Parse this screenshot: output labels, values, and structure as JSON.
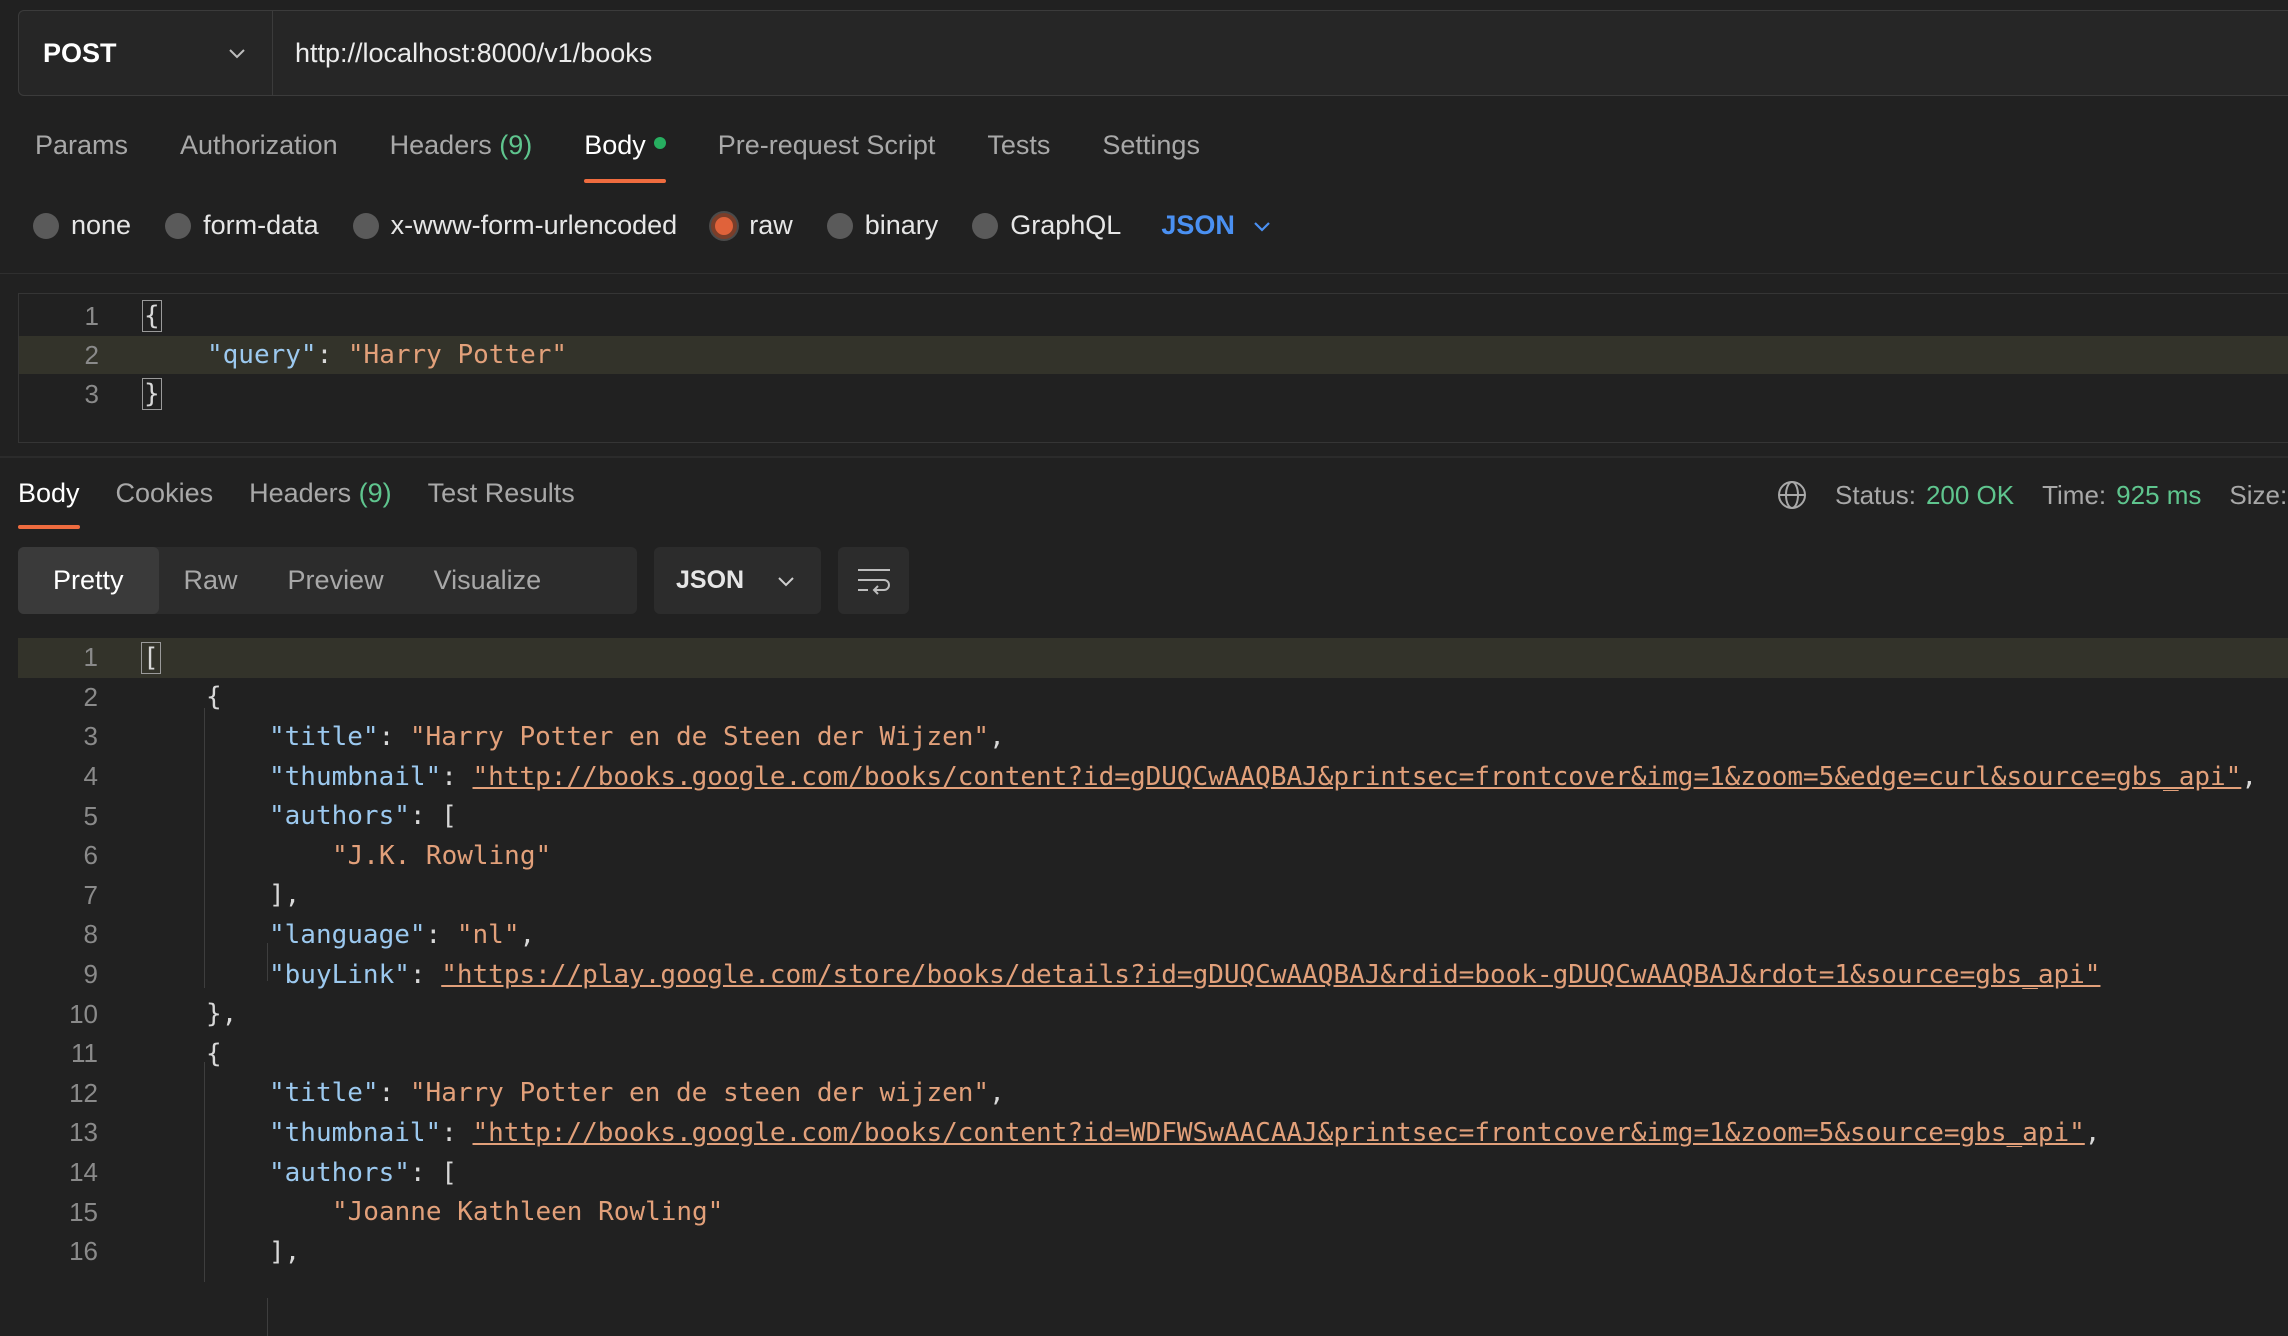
{
  "request": {
    "method": "POST",
    "url": "http://localhost:8000/v1/books"
  },
  "request_tabs": [
    {
      "label": "Params",
      "count": "",
      "active": false
    },
    {
      "label": "Authorization",
      "count": "",
      "active": false
    },
    {
      "label": "Headers",
      "count": "(9)",
      "active": false
    },
    {
      "label": "Body",
      "count": "",
      "active": true
    },
    {
      "label": "Pre-request Script",
      "count": "",
      "active": false
    },
    {
      "label": "Tests",
      "count": "",
      "active": false
    },
    {
      "label": "Settings",
      "count": "",
      "active": false
    }
  ],
  "body_types": {
    "none": "none",
    "form_data": "form-data",
    "urlencoded": "x-www-form-urlencoded",
    "raw": "raw",
    "binary": "binary",
    "graphql": "GraphQL",
    "selected": "raw",
    "language": "JSON"
  },
  "request_body": {
    "line_numbers": [
      "1",
      "2",
      "3"
    ],
    "open": "{",
    "key": "\"query\"",
    "value": "\"Harry Potter\"",
    "close": "}"
  },
  "response_tabs": [
    {
      "label": "Body",
      "count": "",
      "active": true
    },
    {
      "label": "Cookies",
      "count": "",
      "active": false
    },
    {
      "label": "Headers",
      "count": "(9)",
      "active": false
    },
    {
      "label": "Test Results",
      "count": "",
      "active": false
    }
  ],
  "status": {
    "status_label": "Status:",
    "status_value": "200 OK",
    "time_label": "Time:",
    "time_value": "925 ms",
    "size_label": "Size:"
  },
  "view_modes": {
    "pretty": "Pretty",
    "raw": "Raw",
    "preview": "Preview",
    "visualize": "Visualize",
    "format": "JSON"
  },
  "response_body": {
    "line_numbers": [
      "1",
      "2",
      "3",
      "4",
      "5",
      "6",
      "7",
      "8",
      "9",
      "10",
      "11",
      "12",
      "13",
      "14",
      "15",
      "16"
    ],
    "b1": {
      "title": "\"Harry Potter en de Steen der Wijzen\"",
      "thumbnail": "\"http://books.google.com/books/content?id=gDUQCwAAQBAJ&printsec=frontcover&img=1&zoom=5&edge=curl&source=gbs_api\"",
      "author": "\"J.K. Rowling\"",
      "language": "\"nl\"",
      "buyLink": "\"https://play.google.com/store/books/details?id=gDUQCwAAQBAJ&rdid=book-gDUQCwAAQBAJ&rdot=1&source=gbs_api\""
    },
    "b2": {
      "title": "\"Harry Potter en de steen der wijzen\"",
      "thumbnail": "\"http://books.google.com/books/content?id=WDFWSwAACAAJ&printsec=frontcover&img=1&zoom=5&source=gbs_api\"",
      "author": "\"Joanne Kathleen Rowling\""
    },
    "keys": {
      "title": "\"title\"",
      "thumbnail": "\"thumbnail\"",
      "authors": "\"authors\"",
      "language": "\"language\"",
      "buyLink": "\"buyLink\""
    }
  },
  "icons": {
    "method_dropdown": "chevron-down-icon",
    "language_dropdown": "chevron-down-icon",
    "globe": "globe-icon",
    "wrap": "wrap-lines-icon"
  },
  "colors": {
    "accent": "#ef6c3f",
    "success": "#5fc58e",
    "link_blue": "#4a90f2",
    "json_key": "#9cc9ef",
    "json_string": "#e2a07a"
  }
}
